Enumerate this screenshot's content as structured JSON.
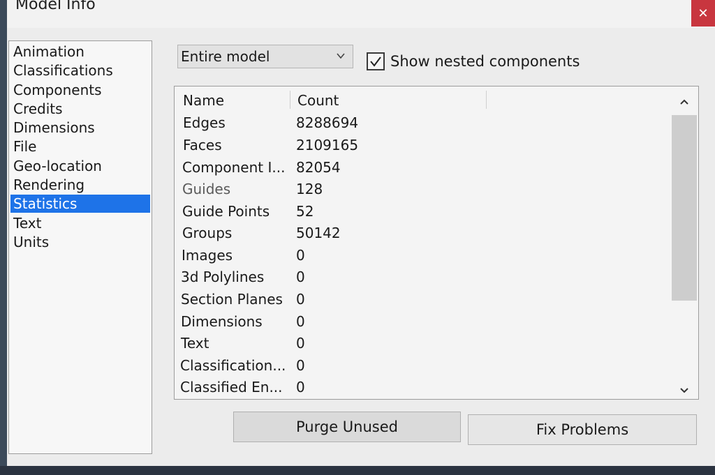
{
  "window": {
    "title": "Model Info",
    "close_glyph": "✕"
  },
  "sidebar": {
    "items": [
      {
        "label": "Animation",
        "selected": false
      },
      {
        "label": "Classifications",
        "selected": false
      },
      {
        "label": "Components",
        "selected": false
      },
      {
        "label": "Credits",
        "selected": false
      },
      {
        "label": "Dimensions",
        "selected": false
      },
      {
        "label": "File",
        "selected": false
      },
      {
        "label": "Geo-location",
        "selected": false
      },
      {
        "label": "Rendering",
        "selected": false
      },
      {
        "label": "Statistics",
        "selected": true
      },
      {
        "label": "Text",
        "selected": false
      },
      {
        "label": "Units",
        "selected": false
      }
    ]
  },
  "scope": {
    "value": "Entire model"
  },
  "nested": {
    "label": "Show nested components",
    "checked": true
  },
  "table": {
    "headers": {
      "name": "Name",
      "count": "Count"
    },
    "rows": [
      {
        "name": "Edges",
        "count": "8288694"
      },
      {
        "name": "Faces",
        "count": "2109165"
      },
      {
        "name": "Component I...",
        "count": "82054"
      },
      {
        "name": "Guides",
        "count": "128"
      },
      {
        "name": "Guide Points",
        "count": "52"
      },
      {
        "name": "Groups",
        "count": "50142"
      },
      {
        "name": "Images",
        "count": "0"
      },
      {
        "name": "3d Polylines",
        "count": "0"
      },
      {
        "name": "Section Planes",
        "count": "0"
      },
      {
        "name": "Dimensions",
        "count": "0"
      },
      {
        "name": "Text",
        "count": "0"
      },
      {
        "name": "Classification...",
        "count": "0"
      },
      {
        "name": "Classified En...",
        "count": "0"
      }
    ]
  },
  "buttons": {
    "purge": "Purge Unused",
    "fix": "Fix Problems"
  },
  "colors": {
    "selection": "#1e73e8",
    "close": "#c8363f"
  }
}
